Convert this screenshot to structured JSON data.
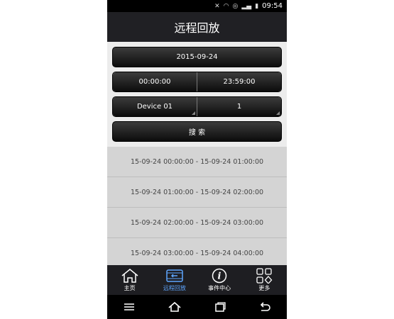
{
  "status_bar": {
    "time": "09:54"
  },
  "header": {
    "title": "远程回放"
  },
  "form": {
    "date": "2015-09-24",
    "start_time": "00:00:00",
    "end_time": "23:59:00",
    "device": "Device 01",
    "channel": "1",
    "search_label": "搜 索"
  },
  "results": [
    "15-09-24 00:00:00 - 15-09-24 01:00:00",
    "15-09-24 01:00:00 - 15-09-24 02:00:00",
    "15-09-24 02:00:00 - 15-09-24 03:00:00",
    "15-09-24 03:00:00 - 15-09-24 04:00:00"
  ],
  "tabs": [
    {
      "label": "主页",
      "icon": "home-icon"
    },
    {
      "label": "远程回放",
      "icon": "playback-icon"
    },
    {
      "label": "事件中心",
      "icon": "info-icon"
    },
    {
      "label": "更多",
      "icon": "more-grid-icon"
    }
  ],
  "active_tab": "远程回放",
  "colors": {
    "accent": "#5ea6ff",
    "bar": "#1e1e22",
    "list_bg": "#d4d4d4"
  }
}
